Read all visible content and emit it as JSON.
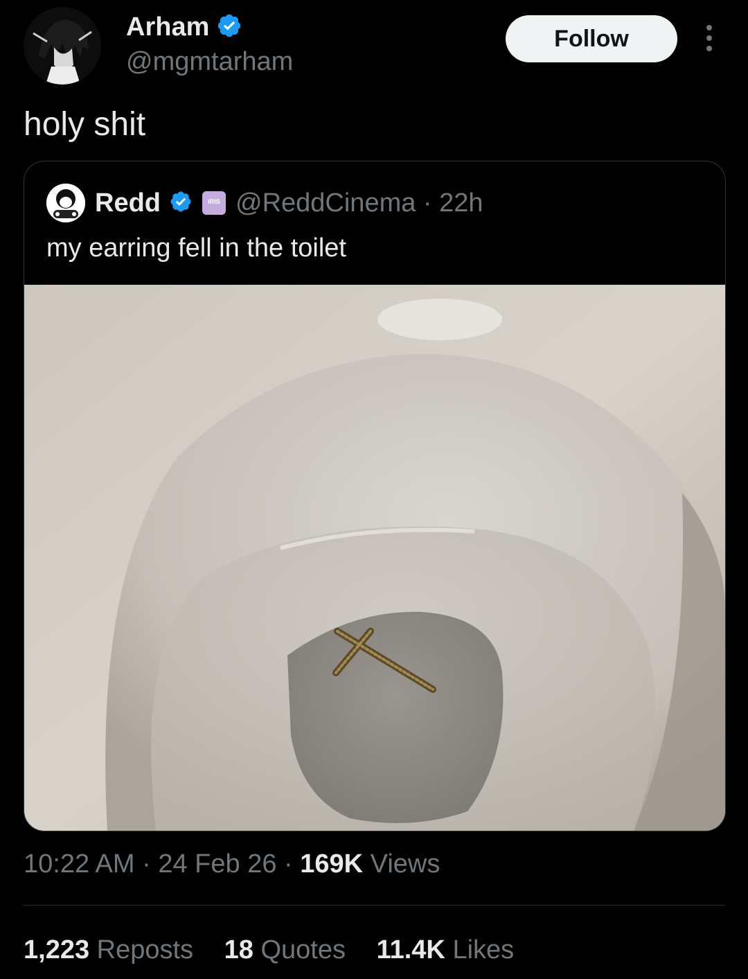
{
  "tweet": {
    "author_name": "Arham",
    "author_handle": "@mgmtarham",
    "follow_label": "Follow",
    "text": "holy shit",
    "time": "10:22 AM",
    "date": "24 Feb 26",
    "views_count": "169K",
    "views_label": "Views"
  },
  "quote": {
    "author_name": "Redd",
    "author_handle": "@ReddCinema",
    "age": "22h",
    "affiliate_badge_text": "IRIS",
    "text": "my earring fell in the toilet"
  },
  "stats": {
    "reposts_count": "1,223",
    "reposts_label": "Reposts",
    "quotes_count": "18",
    "quotes_label": "Quotes",
    "likes_count": "11.4K",
    "likes_label": "Likes"
  },
  "colors": {
    "background": "#000000",
    "text_primary": "#e7e9ea",
    "text_secondary": "#71767b",
    "verified": "#1d9bf0",
    "follow_bg": "#eff3f4"
  },
  "icons": {
    "verified": "verified-badge-icon",
    "more": "more-dots-icon"
  }
}
